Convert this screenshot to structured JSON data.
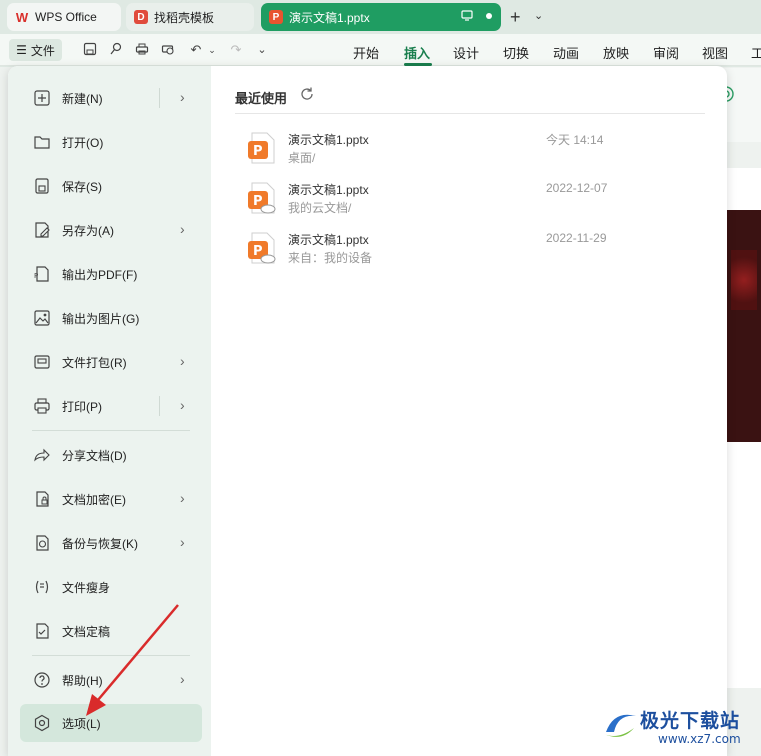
{
  "tabs": {
    "wps_label": "WPS Office",
    "template_label": "找稻壳模板",
    "doc_label": "演示文稿1.pptx"
  },
  "toolbar": {
    "file_label": "文件",
    "ribbon_tabs": [
      "开始",
      "插入",
      "设计",
      "切换",
      "动画",
      "放映",
      "审阅",
      "视图",
      "工"
    ],
    "active_tab": "插入"
  },
  "menu": {
    "items": [
      {
        "label": "新建(N)",
        "icon": "new-icon",
        "submenu": true
      },
      {
        "label": "打开(O)",
        "icon": "folder-open-icon",
        "submenu": false
      },
      {
        "label": "保存(S)",
        "icon": "save-icon",
        "submenu": false
      },
      {
        "label": "另存为(A)",
        "icon": "save-as-icon",
        "submenu": true
      },
      {
        "label": "输出为PDF(F)",
        "icon": "pdf-icon",
        "submenu": false
      },
      {
        "label": "输出为图片(G)",
        "icon": "image-icon",
        "submenu": false
      },
      {
        "label": "文件打包(R)",
        "icon": "package-icon",
        "submenu": true
      },
      {
        "label": "打印(P)",
        "icon": "print-icon",
        "submenu": true
      },
      {
        "label": "分享文档(D)",
        "icon": "share-icon",
        "submenu": false
      },
      {
        "label": "文档加密(E)",
        "icon": "lock-icon",
        "submenu": true
      },
      {
        "label": "备份与恢复(K)",
        "icon": "backup-icon",
        "submenu": true
      },
      {
        "label": "文件瘦身",
        "icon": "slim-icon",
        "submenu": false
      },
      {
        "label": "文档定稿",
        "icon": "finalize-icon",
        "submenu": false
      },
      {
        "label": "帮助(H)",
        "icon": "help-icon",
        "submenu": true
      },
      {
        "label": "选项(L)",
        "icon": "options-icon",
        "submenu": false
      }
    ]
  },
  "recent": {
    "title": "最近使用",
    "files": [
      {
        "name": "演示文稿1.pptx",
        "path": "桌面/",
        "time": "今天 14:14",
        "cloud": false
      },
      {
        "name": "演示文稿1.pptx",
        "path": "我的云文档/",
        "time": "2022-12-07",
        "cloud": true
      },
      {
        "name": "演示文稿1.pptx",
        "path": "来自：我的设备",
        "time": "2022-11-29",
        "cloud": true
      }
    ]
  },
  "watermark": {
    "text": "极光下载站",
    "url": "www.xz7.com"
  },
  "colors": {
    "accent": "#1a7f4e",
    "doc_tab": "#1f9d62",
    "ppt_icon": "#e8742f",
    "arrow": "#d92b2b"
  }
}
